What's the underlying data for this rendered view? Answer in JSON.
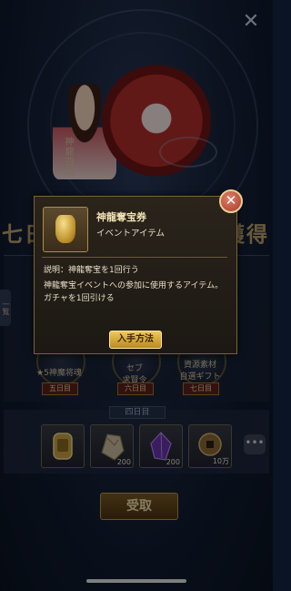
{
  "character": {
    "name": "神龍四司"
  },
  "banner": {
    "title_left": "七日",
    "title_right": "ーナス獲得"
  },
  "side_tab": {
    "label": "一覧"
  },
  "days": [
    {
      "title": "★5神魔将魂",
      "tag": "五日目"
    },
    {
      "title": "セブ\n求賢令",
      "tag": "六日目"
    },
    {
      "title": "資源素材\n自選ギフト",
      "tag": "七日目"
    }
  ],
  "rewards_section": {
    "label": "四日目"
  },
  "rewards": [
    {
      "icon": "ticket-icon",
      "amount": ""
    },
    {
      "icon": "ore-icon",
      "amount": "200"
    },
    {
      "icon": "crystal-icon",
      "amount": "200"
    },
    {
      "icon": "coin-icon",
      "amount": "10万"
    }
  ],
  "receive_button": {
    "label": "受取"
  },
  "popup": {
    "item_name": "神龍奪宝券",
    "item_type": "イベントアイテム",
    "description_short": "説明：神龍奪宝を1回行う",
    "description_long": "神龍奪宝イベントへの参加に使用するアイテム。ガチャを1回引ける",
    "how_to_get_button": "入手方法",
    "close_symbol": "✕"
  },
  "colors": {
    "accent_gold": "#b8954a",
    "popup_bg": "#221d16",
    "close_red": "#a43a2a"
  }
}
